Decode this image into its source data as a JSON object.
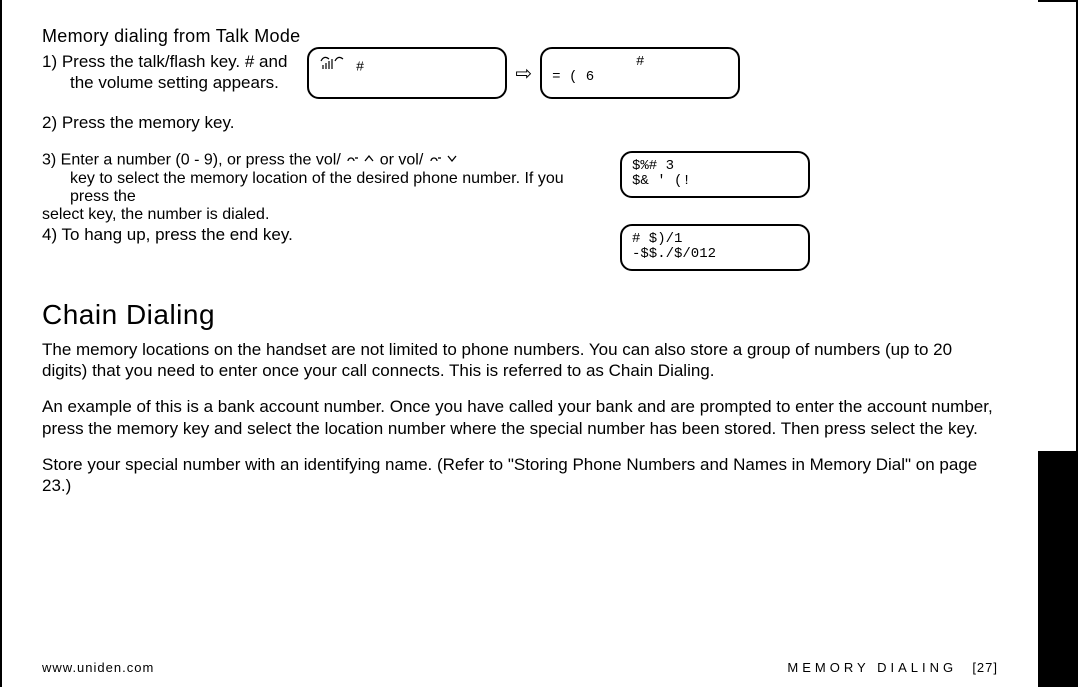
{
  "talk_mode": {
    "heading": "Memory dialing from Talk Mode",
    "step1_a": "1) Press the",
    "step1_key": "talk/flash",
    "step1_b": " key.   #    and",
    "step1_c": "the volume setting appears.",
    "step2_a": "2) Press the",
    "step2_key": "memory",
    "step2_b": " key.",
    "step3_a": "3) Enter a number (",
    "step3_range": "0 - 9",
    "step3_b": "), or press the",
    "step3_key1": "vol/",
    "step3_c": " or vol/",
    "step3_d": "key to select the memory location of the desired phone number. If you press the",
    "step3_key2": "select",
    "step3_e": " key, the number is dialed.",
    "step4_a": "4) To hang up, press the",
    "step4_key": "end",
    "step4_b": " key."
  },
  "lcd": {
    "top_left": "#",
    "top_right_l1": "#",
    "top_right_l2": "=    ( 6",
    "mem_l1": "$%#   3",
    "mem_l2": "$& ' (!",
    "dial_l1": "   #   $)/1",
    "dial_l2": "-$$./$/012"
  },
  "chain": {
    "title": "Chain Dialing",
    "p1": "The memory locations on the handset are not limited to phone numbers. You can also store a group of numbers (up to 20 digits) that you need to enter once your call connects. This is referred to as Chain Dialing.",
    "p2_a": "An example of this is a bank account number. Once you have called your bank and are prompted to enter the account number, press the",
    "p2_key1": "memory",
    "p2_b": " key and select the location number where the special number has been stored. Then press",
    "p2_key2": "select",
    "p2_c": "the  key.",
    "p3": "Store your special number with an identifying name. (Refer to \"Storing Phone Numbers and Names in Memory Dial\" on page 23.)"
  },
  "footer": {
    "url": "www.uniden.com",
    "section": "MEMORY DIALING",
    "page": "[27]"
  }
}
